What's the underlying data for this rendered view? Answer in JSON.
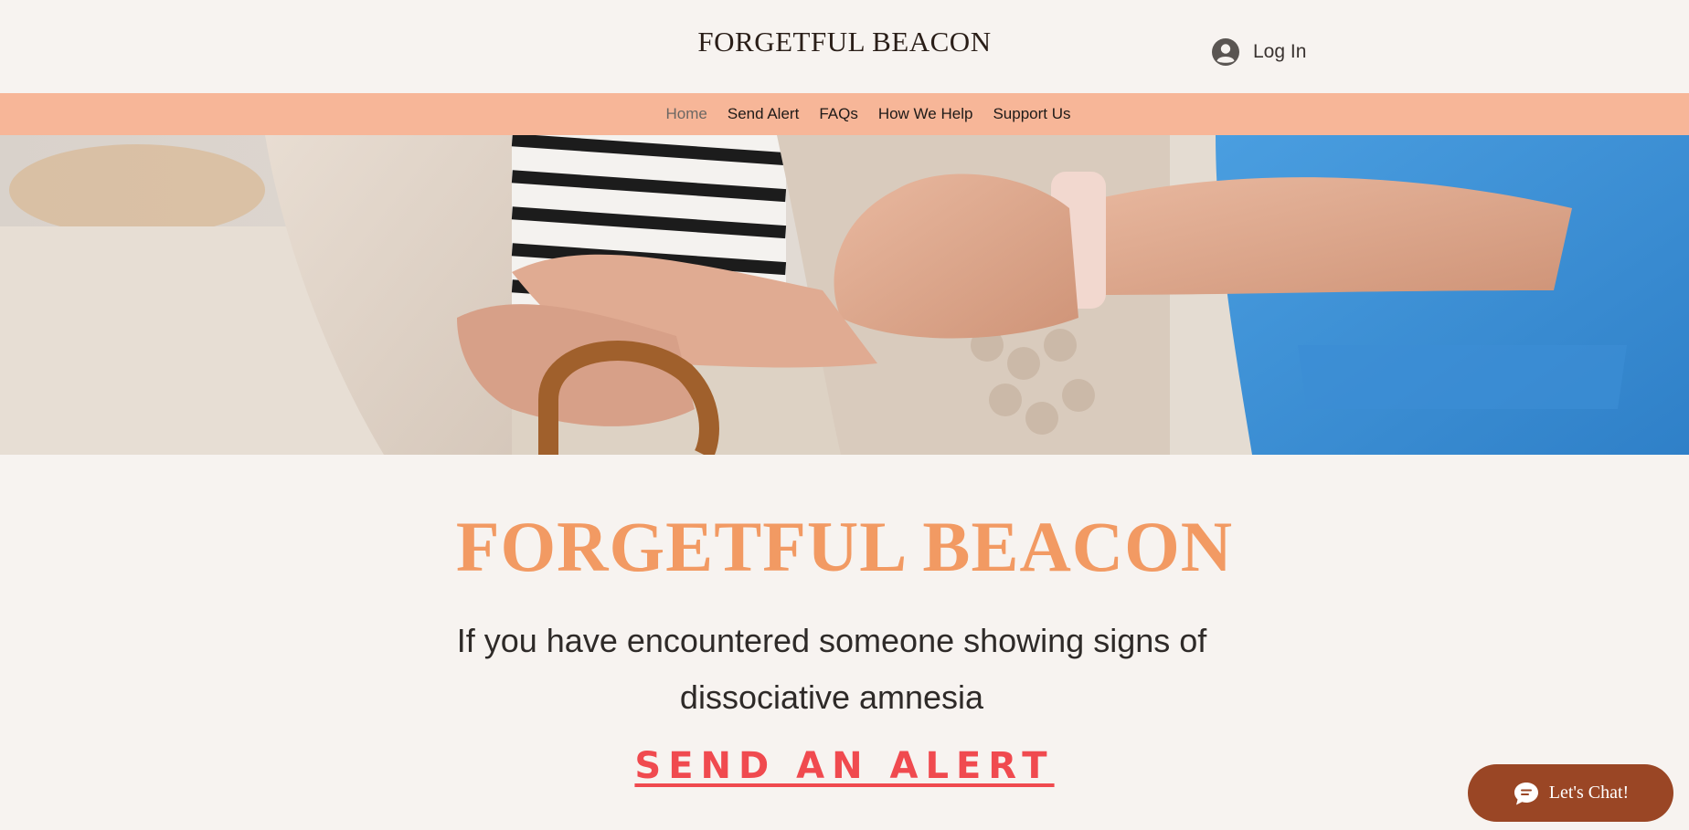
{
  "header": {
    "site_title": "FORGETFUL BEACON",
    "login_label": "Log In",
    "login_icon": "user-avatar-icon"
  },
  "nav": {
    "items": [
      "Home",
      "Send Alert",
      "FAQs",
      "How We Help",
      "Support Us"
    ],
    "active": "Home"
  },
  "hero": {
    "image": "caregiver holding elderly person's hands on a walking cane"
  },
  "main": {
    "title": "FORGETFUL BEACON",
    "subtitle": "If you have encountered someone showing signs of dissociative amnesia",
    "cta_label": "SEND AN ALERT"
  },
  "chat": {
    "label": "Let's Chat!",
    "icon": "chat-bubble-icon"
  },
  "colors": {
    "background": "#f7f3f0",
    "nav_bar": "#f7b698",
    "title_accent": "#f29a63",
    "cta_red": "#f04a4f",
    "chat_button": "#9a4625"
  }
}
